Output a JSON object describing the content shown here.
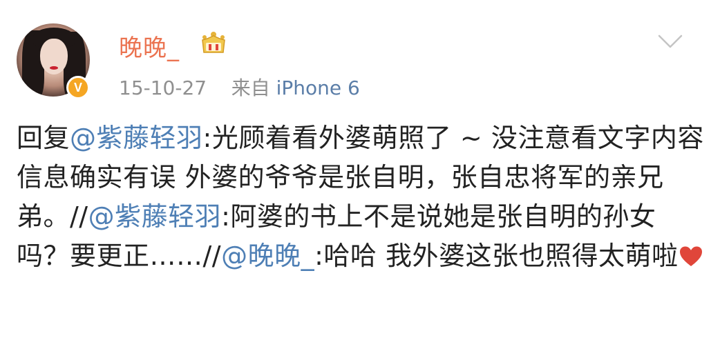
{
  "post": {
    "username": "晚晚_",
    "date": "15-10-27",
    "source_prefix": "来自",
    "source": "iPhone 6",
    "verified_badge": "V",
    "icons": {
      "crown": "crown-icon",
      "heart": "heart-icon",
      "chevron": "chevron-down-icon"
    },
    "colors": {
      "username": "#eb7350",
      "mention": "#4e7fb5",
      "meta": "#8f8f8f",
      "heart": "#e0463a"
    },
    "content": {
      "seg1": "回复",
      "mention1": "@紫藤轻羽",
      "seg2": ":光顾着看外婆萌照了 ~ 没注意看文字内容 信息确实有误 外婆的爷爷是张自明，张自忠将军的亲兄弟。//",
      "mention2": "@紫藤轻羽",
      "seg3": ":阿婆的书上不是说她是张自明的孙女吗？要更正……//",
      "mention3": "@晚晚_",
      "seg4": ":哈哈 我外婆这张也照得太萌啦"
    }
  }
}
